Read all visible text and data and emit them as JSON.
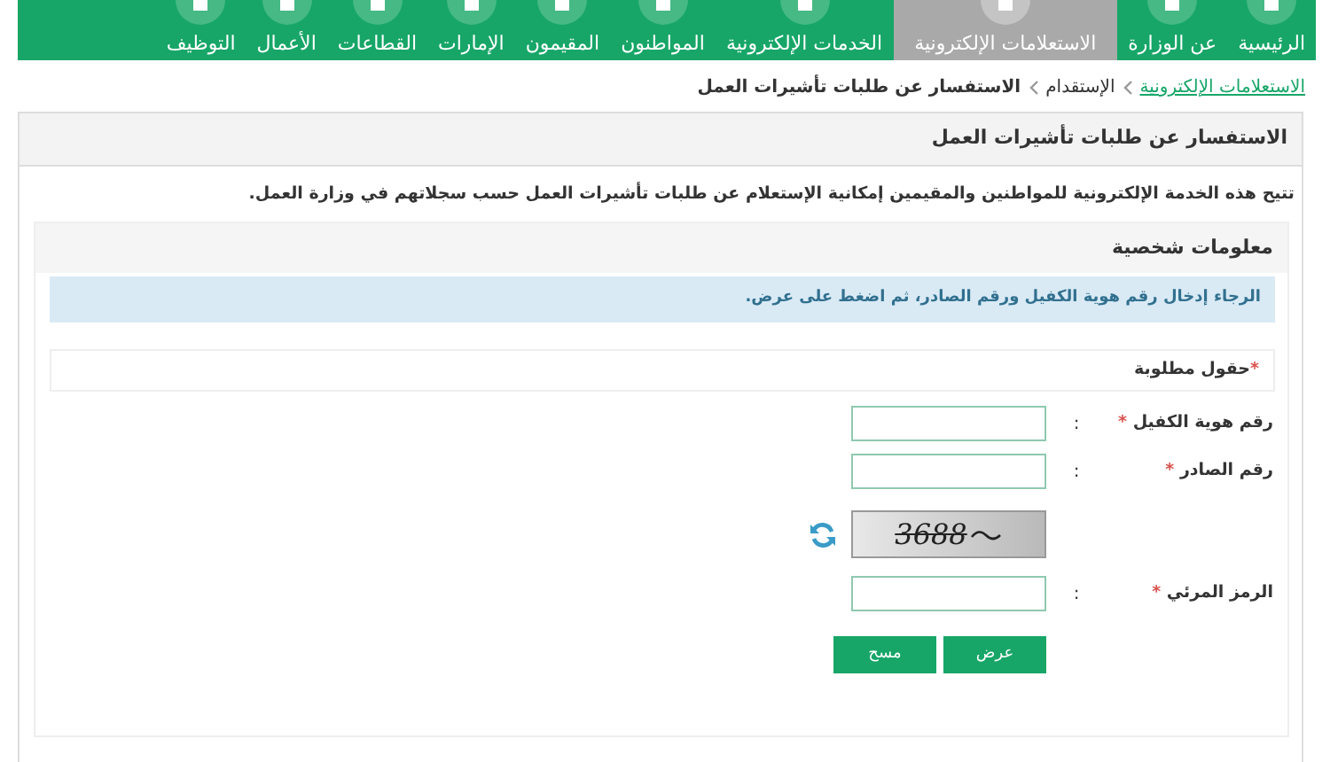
{
  "nav": {
    "items": [
      {
        "label": "الرئيسية",
        "selected": false
      },
      {
        "label": "عن الوزارة",
        "selected": false
      },
      {
        "label": "الاستعلامات الإلكترونية",
        "selected": true
      },
      {
        "label": "الخدمات الإلكترونية",
        "selected": false
      },
      {
        "label": "المواطنون",
        "selected": false
      },
      {
        "label": "المقيمون",
        "selected": false
      },
      {
        "label": "الإمارات",
        "selected": false
      },
      {
        "label": "القطاعات",
        "selected": false
      },
      {
        "label": "الأعمال",
        "selected": false
      },
      {
        "label": "التوظيف",
        "selected": false
      }
    ]
  },
  "breadcrumb": [
    {
      "text": "الاستعلامات الإلكترونية",
      "kind": "link"
    },
    {
      "text": "الإستقدام",
      "kind": "plain"
    },
    {
      "text": "الاستفسار عن طلبات تأشيرات العمل",
      "kind": "current"
    }
  ],
  "panel": {
    "title": "الاستفسار عن طلبات تأشيرات العمل",
    "description": "تتيح هذه الخدمة الإلكترونية للمواطنين والمقيمين إمكانية الإستعلام عن طلبات تأشيرات العمل حسب سجلاتهم في وزارة العمل.",
    "section": {
      "title": "معلومات شخصية",
      "alert": "الرجاء إدخال رقم هوية الكفيل ورقم الصادر، ثم اضغط على عرض.",
      "required_note": {
        "mark": "*",
        "text": "حقول مطلوبة"
      },
      "fields": [
        {
          "kind": "input",
          "label": "رقم هوية الكفيل",
          "mark": "*",
          "colon": ":"
        },
        {
          "kind": "input",
          "label": "رقم الصادر",
          "mark": "*",
          "colon": ":"
        },
        {
          "kind": "captcha",
          "code": "3688"
        },
        {
          "kind": "input",
          "label": "الرمز المرئي",
          "mark": "*",
          "colon": ":"
        }
      ],
      "buttons": [
        "عرض",
        "مسح"
      ]
    }
  }
}
